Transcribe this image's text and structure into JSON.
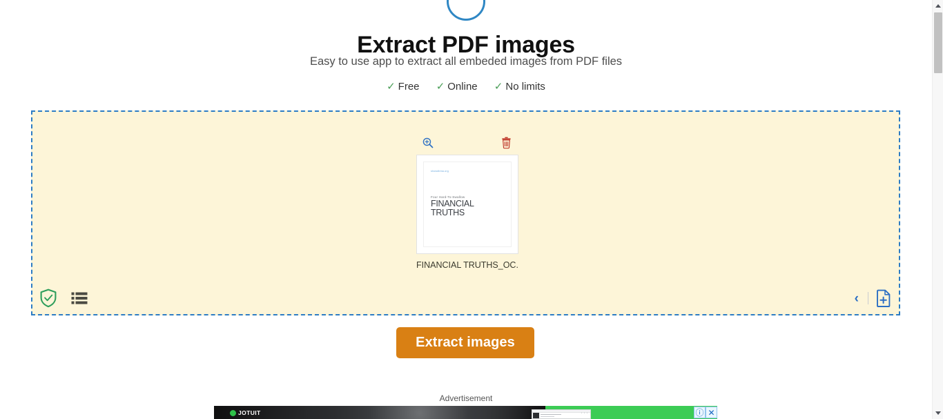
{
  "header": {
    "title": "Extract PDF images",
    "subtitle": "Easy to use app to extract all embeded images from PDF files",
    "features": [
      {
        "check": "✓",
        "label": "Free"
      },
      {
        "check": "✓",
        "label": "Online"
      },
      {
        "check": "✓",
        "label": "No limits"
      }
    ],
    "logo_icon": "circular-logo-icon"
  },
  "dropzone": {
    "file": {
      "name": "FINANCIAL TRUTHS_OC...",
      "zoom_icon": "magnify-plus-icon",
      "delete_icon": "trash-icon",
      "thumbnail": {
        "url_line": "showdbma.org",
        "kicker": "Four Hard-To-Swallow",
        "title_line1": "FINANCIAL",
        "title_line2": "TRUTHS"
      }
    },
    "toolbar_left": [
      {
        "icon": "shield-check-icon",
        "name": "security-shield"
      },
      {
        "icon": "list-view-icon",
        "name": "list-view-toggle"
      }
    ],
    "toolbar_right": [
      {
        "icon": "chevron-left-icon",
        "glyph": "‹",
        "name": "previous-button"
      },
      {
        "icon": "add-file-icon",
        "name": "add-file-button"
      }
    ]
  },
  "actions": {
    "extract_label": "Extract images"
  },
  "advertisement": {
    "label": "Advertisement",
    "brand": "JOTUIT",
    "info_icon": "ⓘ",
    "close_icon": "✕"
  },
  "scrollbar": {
    "up_icon": "scroll-up-arrow-icon",
    "down_icon": "scroll-down-arrow-icon"
  },
  "colors": {
    "accent_blue": "#2c7cc4",
    "dropzone_bg": "#fdf5d8",
    "button_orange": "#d98014",
    "check_green": "#4a9e57",
    "trash_red": "#c0392b",
    "ad_green": "#3ccc55"
  }
}
